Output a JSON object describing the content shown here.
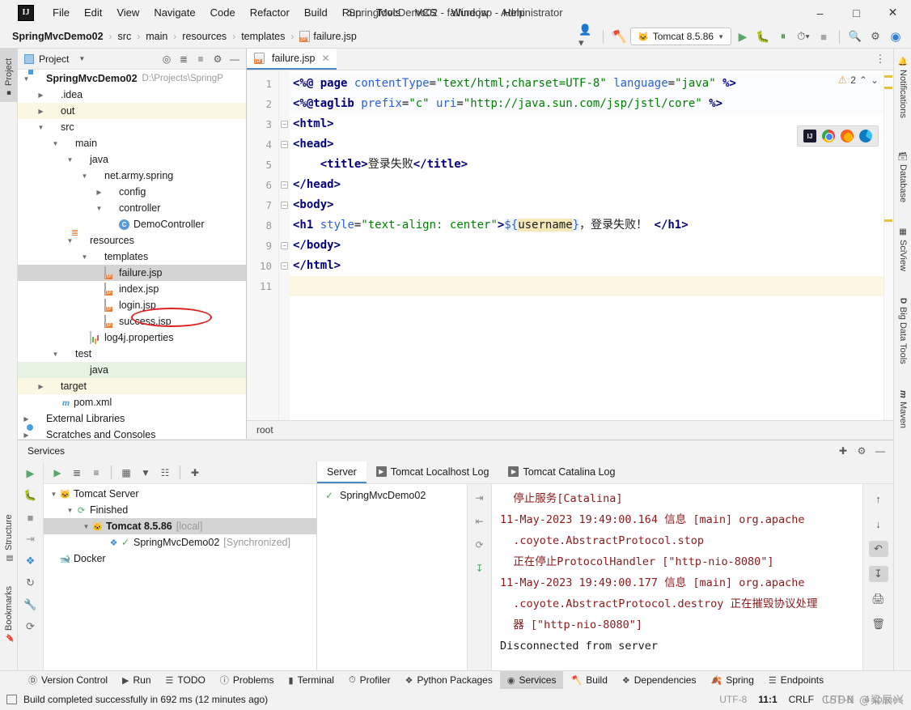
{
  "window": {
    "title": "SpringMvcDemo02 - failure.jsp - Administrator",
    "minimize": "–",
    "maximize": "□",
    "close": "✕",
    "logo": "IJ"
  },
  "menu": {
    "items": [
      "File",
      "Edit",
      "View",
      "Navigate",
      "Code",
      "Refactor",
      "Build",
      "Run",
      "Tools",
      "VCS",
      "Window",
      "Help"
    ]
  },
  "breadcrumbs": {
    "items": [
      "SpringMvcDemo02",
      "src",
      "main",
      "resources",
      "templates",
      "failure.jsp"
    ],
    "separator": "›"
  },
  "toolbar": {
    "run_config": "Tomcat 8.5.86",
    "user_icon": "user-icon",
    "build_icon": "hammer-icon",
    "run_icon": "▶",
    "debug_icon": "debug-icon",
    "coverage_icon": "coverage-icon",
    "profile_icon": "profile-icon",
    "stop_icon": "■",
    "search_icon": "🔍",
    "settings_icon": "⚙",
    "ai_icon": "ai-icon"
  },
  "left_strip": {
    "tabs": [
      "Project",
      "Structure",
      "Bookmarks"
    ]
  },
  "right_strip": {
    "tabs": [
      "Notifications",
      "Database",
      "SciView",
      "Big Data Tools",
      "Maven"
    ]
  },
  "project_panel": {
    "title": "Project",
    "header_icons": [
      "locate-icon",
      "expand-all-icon",
      "collapse-all-icon",
      "gear-icon",
      "minimize-icon"
    ],
    "tree": [
      {
        "depth": 0,
        "arrow": "v",
        "icon": "module",
        "label": "SpringMvcDemo02",
        "bold": true,
        "path": "D:\\Projects\\SpringP",
        "state": "normal"
      },
      {
        "depth": 1,
        "arrow": ">",
        "icon": "folder-grey",
        "label": ".idea",
        "bold": false,
        "path": "",
        "state": "normal"
      },
      {
        "depth": 1,
        "arrow": ">",
        "icon": "folder-orange",
        "label": "out",
        "bold": false,
        "path": "",
        "state": "yellow"
      },
      {
        "depth": 1,
        "arrow": "v",
        "icon": "folder-grey",
        "label": "src",
        "bold": false,
        "path": "",
        "state": "normal"
      },
      {
        "depth": 2,
        "arrow": "v",
        "icon": "folder-grey",
        "label": "main",
        "bold": false,
        "path": "",
        "state": "normal"
      },
      {
        "depth": 3,
        "arrow": "v",
        "icon": "folder-blue",
        "label": "java",
        "bold": false,
        "path": "",
        "state": "normal"
      },
      {
        "depth": 4,
        "arrow": "v",
        "icon": "package",
        "label": "net.army.spring",
        "bold": false,
        "path": "",
        "state": "normal"
      },
      {
        "depth": 5,
        "arrow": ">",
        "icon": "package",
        "label": "config",
        "bold": false,
        "path": "",
        "state": "normal"
      },
      {
        "depth": 5,
        "arrow": "v",
        "icon": "package",
        "label": "controller",
        "bold": false,
        "path": "",
        "state": "normal"
      },
      {
        "depth": 6,
        "arrow": "",
        "icon": "class",
        "label": "DemoController",
        "bold": false,
        "path": "",
        "state": "normal"
      },
      {
        "depth": 3,
        "arrow": "v",
        "icon": "resources",
        "label": "resources",
        "bold": false,
        "path": "",
        "state": "normal"
      },
      {
        "depth": 4,
        "arrow": "v",
        "icon": "folder-grey",
        "label": "templates",
        "bold": false,
        "path": "",
        "state": "normal"
      },
      {
        "depth": 5,
        "arrow": "",
        "icon": "jsp",
        "label": "failure.jsp",
        "bold": false,
        "path": "",
        "state": "selected"
      },
      {
        "depth": 5,
        "arrow": "",
        "icon": "jsp",
        "label": "index.jsp",
        "bold": false,
        "path": "",
        "state": "normal"
      },
      {
        "depth": 5,
        "arrow": "",
        "icon": "jsp",
        "label": "login.jsp",
        "bold": false,
        "path": "",
        "state": "normal"
      },
      {
        "depth": 5,
        "arrow": "",
        "icon": "jsp",
        "label": "success.jsp",
        "bold": false,
        "path": "",
        "state": "normal"
      },
      {
        "depth": 4,
        "arrow": "",
        "icon": "props",
        "label": "log4j.properties",
        "bold": false,
        "path": "",
        "state": "normal"
      },
      {
        "depth": 2,
        "arrow": "v",
        "icon": "folder-grey",
        "label": "test",
        "bold": false,
        "path": "",
        "state": "normal"
      },
      {
        "depth": 3,
        "arrow": "",
        "icon": "folder-green",
        "label": "java",
        "bold": false,
        "path": "",
        "state": "green"
      },
      {
        "depth": 1,
        "arrow": ">",
        "icon": "folder-orange",
        "label": "target",
        "bold": false,
        "path": "",
        "state": "yellow"
      },
      {
        "depth": 2,
        "arrow": "",
        "icon": "maven",
        "label": "pom.xml",
        "bold": false,
        "path": "",
        "state": "normal"
      },
      {
        "depth": 0,
        "arrow": ">",
        "icon": "libs",
        "label": "External Libraries",
        "bold": false,
        "path": "",
        "state": "normal"
      },
      {
        "depth": 0,
        "arrow": ">",
        "icon": "scratch",
        "label": "Scratches and Consoles",
        "bold": false,
        "path": "",
        "state": "normal"
      }
    ]
  },
  "editor": {
    "tab_label": "failure.jsp",
    "tab_close": "✕",
    "inspection_count": "2",
    "inspection_up": "⌃",
    "inspection_down": "⌄",
    "status_text": "root",
    "browser_popup": [
      "IJ",
      "chrome-icon",
      "firefox-icon",
      "edge-icon"
    ],
    "lines": [
      {
        "n": "1",
        "fold": "",
        "html": "<span class='tok-dir'>&lt;%@</span> <span class='tok-dir'>page</span> <span class='tok-attr'>contentType</span>=<span class='tok-str'>\"text/html;charset=UTF-8\"</span> <span class='tok-attr'>language</span>=<span class='tok-str'>\"java\"</span> <span class='tok-dir'>%&gt;</span>",
        "bg": "l1"
      },
      {
        "n": "2",
        "fold": "",
        "html": "<span class='tok-dir'>&lt;%@taglib</span> <span class='tok-attr'>prefix</span>=<span class='tok-str'>\"c\"</span> <span class='tok-attr'>uri</span>=<span class='tok-str'>\"http://java.sun.com/jsp/jstl/core\"</span> <span class='tok-dir'>%&gt;</span>",
        "bg": "l2"
      },
      {
        "n": "3",
        "fold": "-",
        "html": "<span class='tok-tag'>&lt;html&gt;</span>",
        "bg": ""
      },
      {
        "n": "4",
        "fold": "-",
        "html": "<span class='tok-tag'>&lt;head&gt;</span>",
        "bg": ""
      },
      {
        "n": "5",
        "fold": "",
        "html": "    <span class='tok-tag'>&lt;title&gt;</span><span class='tok-txt'>登录失败</span><span class='tok-tag'>&lt;/title&gt;</span>",
        "bg": ""
      },
      {
        "n": "6",
        "fold": "-",
        "html": "<span class='tok-tag'>&lt;/head&gt;</span>",
        "bg": ""
      },
      {
        "n": "7",
        "fold": "-",
        "html": "<span class='tok-tag'>&lt;body&gt;</span>",
        "bg": ""
      },
      {
        "n": "8",
        "fold": "",
        "html": "<span class='tok-tag'>&lt;h1</span> <span class='tok-attr'>style</span>=<span class='tok-str'>\"text-align: center\"</span><span class='tok-tag'>&gt;</span><span class='el-bg'><span class='tok-el'>${</span><span class='el-hl tok-txt'>username</span><span class='tok-el'>}</span></span><span class='tok-txt'>，登录失败！</span> <span class='tok-tag'>&lt;/h1&gt;</span>",
        "bg": ""
      },
      {
        "n": "9",
        "fold": "-",
        "html": "<span class='tok-tag'>&lt;/body&gt;</span>",
        "bg": ""
      },
      {
        "n": "10",
        "fold": "-",
        "html": "<span class='tok-tag'>&lt;/html&gt;</span>",
        "bg": ""
      },
      {
        "n": "11",
        "fold": "",
        "html": "",
        "bg": "hl"
      }
    ]
  },
  "services": {
    "title": "Services",
    "header_icons": [
      "add-icon",
      "gear-icon",
      "minimize-icon"
    ],
    "run_strip_icons": [
      "run-icon",
      "debug-icon",
      "stop-icon",
      "deploy-icon",
      "edit-config-icon",
      "rerun-icon",
      "settings-icon",
      "refresh-icon"
    ],
    "toolbar_icons": [
      "run-icon",
      "expand-all-icon",
      "collapse-all-icon",
      "group-icon",
      "filter-icon",
      "show-icon",
      "add-icon"
    ],
    "tree": [
      {
        "depth": 0,
        "arrow": "v",
        "icon": "tomcat",
        "label": "Tomcat Server",
        "bold": false,
        "extra": "",
        "state": "normal"
      },
      {
        "depth": 1,
        "arrow": "v",
        "icon": "finished",
        "label": "Finished",
        "bold": false,
        "extra": "",
        "state": "normal"
      },
      {
        "depth": 2,
        "arrow": "v",
        "icon": "tomcat",
        "label": "Tomcat 8.5.86",
        "bold": true,
        "extra": "[local]",
        "state": "selected"
      },
      {
        "depth": 3,
        "arrow": "",
        "icon": "artifact",
        "label": "SpringMvcDemo02",
        "bold": false,
        "extra": "[Synchronized]",
        "state": "normal"
      },
      {
        "depth": 0,
        "arrow": "",
        "icon": "docker",
        "label": "Docker",
        "bold": false,
        "extra": "",
        "state": "normal"
      }
    ],
    "tabs": [
      {
        "label": "Server",
        "icon": "",
        "active": true
      },
      {
        "label": "Tomcat Localhost Log",
        "icon": "console-icon",
        "active": false
      },
      {
        "label": "Tomcat Catalina Log",
        "icon": "console-icon",
        "active": false
      }
    ],
    "deployment_list": [
      {
        "label": "SpringMvcDemo02",
        "status": "ok"
      }
    ],
    "mid_strip_icons": [
      "step-out-icon",
      "step-in-icon",
      "rerun-icon",
      "import-icon"
    ],
    "console_lines": [
      {
        "text": "  停止服务[Catalina]",
        "color": "red"
      },
      {
        "text": "11-May-2023 19:49:00.164 信息 [main] org.apache",
        "color": "red"
      },
      {
        "text": "  .coyote.AbstractProtocol.stop",
        "color": "red"
      },
      {
        "text": "  正在停止ProtocolHandler [\"http-nio-8080\"]",
        "color": "red"
      },
      {
        "text": "11-May-2023 19:49:00.177 信息 [main] org.apache",
        "color": "red"
      },
      {
        "text": "  .coyote.AbstractProtocol.destroy 正在摧毁协议处理",
        "color": "red"
      },
      {
        "text": "  器 [\"http-nio-8080\"]",
        "color": "red"
      },
      {
        "text": "Disconnected from server",
        "color": "black"
      }
    ],
    "console_strip_icons": [
      "scroll-up-icon",
      "scroll-down-icon",
      "soft-wrap-icon",
      "scroll-to-end-icon",
      "print-icon",
      "trash-icon"
    ]
  },
  "bottom_bar": {
    "items": [
      {
        "label": "Version Control",
        "icon": "branch-icon",
        "active": false
      },
      {
        "label": "Run",
        "icon": "▶",
        "active": false
      },
      {
        "label": "TODO",
        "icon": "list-icon",
        "active": false
      },
      {
        "label": "Problems",
        "icon": "error-icon",
        "active": false
      },
      {
        "label": "Terminal",
        "icon": "terminal-icon",
        "active": false
      },
      {
        "label": "Profiler",
        "icon": "profiler-icon",
        "active": false
      },
      {
        "label": "Python Packages",
        "icon": "stack-icon",
        "active": false
      },
      {
        "label": "Services",
        "icon": "services-icon",
        "active": true
      },
      {
        "label": "Build",
        "icon": "hammer-icon",
        "active": false
      },
      {
        "label": "Dependencies",
        "icon": "stack-icon",
        "active": false
      },
      {
        "label": "Spring",
        "icon": "leaf-icon",
        "active": false
      },
      {
        "label": "Endpoints",
        "icon": "endpoints-icon",
        "active": false
      }
    ]
  },
  "status_bar": {
    "message": "Build completed successfully in 692 ms (12 minutes ago)",
    "encoding": "UTF-8",
    "caret": "11:1",
    "line_sep": "CRLF",
    "file_encoding": "UTF-8",
    "indent": "4 spaces",
    "watermark": "CSDN @梁辰兴"
  }
}
